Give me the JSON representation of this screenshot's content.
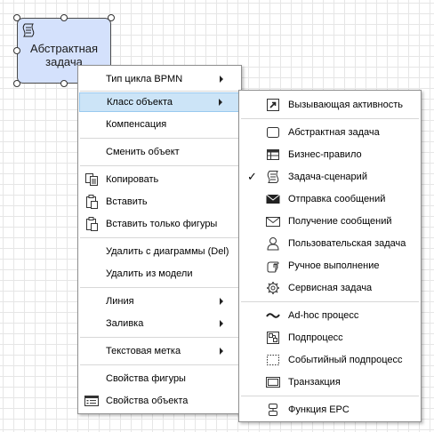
{
  "diagram": {
    "shape_label": "Абстрактная\nзадача"
  },
  "context_menu": {
    "items": [
      {
        "label": "Тип цикла BPMN"
      },
      {
        "label": "Класс объекта"
      },
      {
        "label": "Компенсация"
      },
      {
        "label": "Сменить объект"
      },
      {
        "label": "Копировать",
        "icon": "copy-icon"
      },
      {
        "label": "Вставить",
        "icon": "paste-icon"
      },
      {
        "label": "Вставить только фигуры",
        "icon": "paste-shapes-icon"
      },
      {
        "label": "Удалить с диаграммы (Del)"
      },
      {
        "label": "Удалить из модели"
      },
      {
        "label": "Линия"
      },
      {
        "label": "Заливка"
      },
      {
        "label": "Текстовая метка"
      },
      {
        "label": "Свойства фигуры"
      },
      {
        "label": "Свойства объекта",
        "icon": "properties-icon"
      }
    ]
  },
  "submenu": {
    "items": [
      {
        "label": "Вызывающая активность",
        "icon": "call-activity-icon"
      },
      {
        "label": "Абстрактная задача",
        "icon": "abstract-task-icon"
      },
      {
        "label": "Бизнес-правило",
        "icon": "business-rule-icon"
      },
      {
        "label": "Задача-сценарий",
        "icon": "script-task-icon",
        "checked": true
      },
      {
        "label": "Отправка сообщений",
        "icon": "send-message-icon"
      },
      {
        "label": "Получение сообщений",
        "icon": "receive-message-icon"
      },
      {
        "label": "Пользовательская задача",
        "icon": "user-task-icon"
      },
      {
        "label": "Ручное выполнение",
        "icon": "manual-task-icon"
      },
      {
        "label": "Сервисная задача",
        "icon": "service-task-icon"
      },
      {
        "label": "Ad-hoc процесс",
        "icon": "adhoc-icon"
      },
      {
        "label": "Подпроцесс",
        "icon": "subprocess-icon"
      },
      {
        "label": "Событийный подпроцесс",
        "icon": "event-subprocess-icon"
      },
      {
        "label": "Транзакция",
        "icon": "transaction-icon"
      },
      {
        "label": "Функция EPC",
        "icon": "epc-function-icon"
      }
    ]
  }
}
